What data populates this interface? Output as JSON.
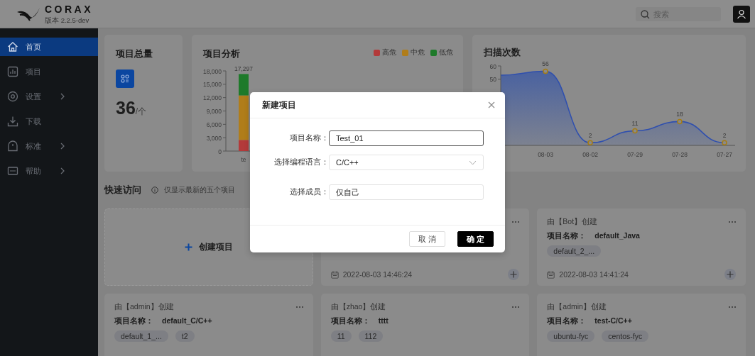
{
  "header": {
    "brand": "CORAX",
    "version": "版本 2.2.5-dev",
    "search": {
      "placeholder": "搜索"
    }
  },
  "sidebar": {
    "items": [
      {
        "label": "首页",
        "selected": true,
        "has_submenu": false
      },
      {
        "label": "项目",
        "selected": false,
        "has_submenu": false
      },
      {
        "label": "设置",
        "selected": false,
        "has_submenu": true
      },
      {
        "label": "下载",
        "selected": false,
        "has_submenu": false
      },
      {
        "label": "标准",
        "selected": false,
        "has_submenu": true
      },
      {
        "label": "帮助",
        "selected": false,
        "has_submenu": true
      }
    ]
  },
  "summary": {
    "title": "项目总量",
    "count": "36",
    "unit": "/个"
  },
  "analysis": {
    "title": "项目分析",
    "chart_data": {
      "type": "bar",
      "stacked": true,
      "categories": [
        "te"
      ],
      "ylim": [
        0,
        18000
      ],
      "yticks": [
        {
          "value": 0,
          "label": "0"
        },
        {
          "value": 3000,
          "label": "3,000"
        },
        {
          "value": 6000,
          "label": "6,000"
        },
        {
          "value": 9000,
          "label": "9,000"
        },
        {
          "value": 12000,
          "label": "12,000"
        },
        {
          "value": 15000,
          "label": "15,000"
        },
        {
          "value": 18000,
          "label": "18,000"
        }
      ],
      "value_labels": [
        "17,297"
      ],
      "series": [
        {
          "name": "高危",
          "color": "#b33a3a",
          "values": [
            2500
          ]
        },
        {
          "name": "中危",
          "color": "#b07d1a",
          "values": [
            10000
          ]
        },
        {
          "name": "低危",
          "color": "#1e7a2a",
          "values": [
            4800
          ]
        }
      ]
    }
  },
  "scans": {
    "title": "扫描次数",
    "chart_data": {
      "type": "area",
      "categories": [
        null,
        "08-03",
        "08-02",
        "07-29",
        "07-28",
        "07-27"
      ],
      "values": [
        53,
        56,
        2,
        11,
        18,
        2
      ],
      "ylim": [
        0,
        60
      ],
      "yticks": [
        50,
        60
      ],
      "value_labels": [
        null,
        "56",
        "2",
        "11",
        "18",
        "2"
      ]
    }
  },
  "quick_access": {
    "title": "快速访问",
    "hint": "仅显示最新的五个项目",
    "items": [
      {
        "kind": "create",
        "label": "创建项目"
      },
      {
        "kind": "project",
        "date": "2022-08-03 14:46:24"
      },
      {
        "kind": "project",
        "creator": "由【Bot】创建",
        "name_label": "项目名称：",
        "name": "default_Java",
        "tags": [
          "default_2_..."
        ],
        "date": "2022-08-03 14:41:24"
      },
      {
        "kind": "project",
        "creator": "由【admin】创建",
        "name_label": "项目名称：",
        "name": "default_C/C++",
        "tags": [
          "default_1_...",
          "t2"
        ]
      },
      {
        "kind": "project",
        "creator": "由【zhao】创建",
        "name_label": "项目名称：",
        "name": "tttt",
        "tags": [
          "11",
          "112"
        ]
      },
      {
        "kind": "project",
        "creator": "由【admin】创建",
        "name_label": "项目名称：",
        "name": "test-C/C++",
        "tags": [
          "ubuntu-fyc",
          "centos-fyc"
        ]
      }
    ]
  },
  "modal": {
    "title": "新建项目",
    "fields": [
      {
        "label": "项目名称：",
        "kind": "text",
        "value": "Test_01",
        "focused": true
      },
      {
        "label": "选择编程语言：",
        "kind": "select",
        "value": "C/C++",
        "focused": false
      },
      {
        "label": "选择成员：",
        "kind": "text",
        "value": "仅自己",
        "focused": false
      }
    ],
    "buttons": [
      {
        "label": "取 消",
        "kind": "secondary"
      },
      {
        "label": "确 定",
        "kind": "primary"
      }
    ]
  }
}
